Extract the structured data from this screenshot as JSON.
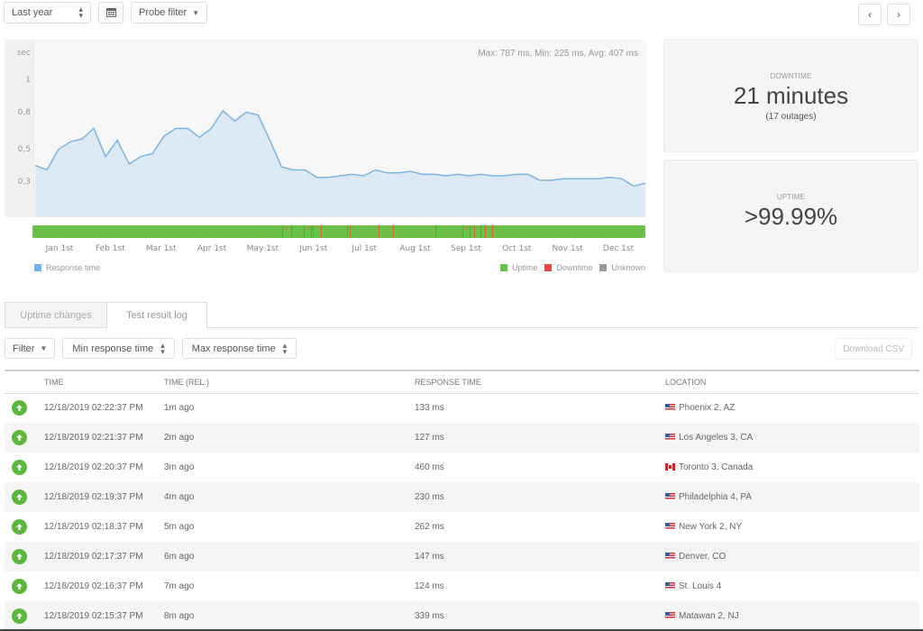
{
  "toolbar": {
    "period_label": "Last year",
    "calendar_icon": "calendar-icon",
    "probe_filter_label": "Probe filter",
    "prev_icon": "chevron-left-icon",
    "next_icon": "chevron-right-icon",
    "prev_glyph": "‹",
    "next_glyph": "›"
  },
  "chart_data": {
    "type": "area",
    "title": "",
    "ylabel": "sec",
    "stats_text": "Max: 787 ms, Min: 225 ms, Avg: 407 ms",
    "ytick_labels": [
      {
        "label": "1",
        "value": 1.0
      },
      {
        "label": "0,8",
        "value": 0.78
      },
      {
        "label": "0,5",
        "value": 0.53
      },
      {
        "label": "0,3",
        "value": 0.31
      }
    ],
    "ylim": [
      0.08,
      1.28
    ],
    "x_labels": [
      "Jan 1st",
      "Feb 1st",
      "Mar 1st",
      "Apr 1st",
      "May 1st",
      "Jun 1st",
      "Jul 1st",
      "Aug 1st",
      "Sep 1st",
      "Oct 1st",
      "Nov 1st",
      "Dec 1st"
    ],
    "series": [
      {
        "name": "Response time",
        "color": "#7cb5e0",
        "fill": "#dde9f5",
        "values": [
          0.43,
          0.4,
          0.54,
          0.59,
          0.61,
          0.68,
          0.49,
          0.6,
          0.44,
          0.49,
          0.51,
          0.63,
          0.68,
          0.68,
          0.62,
          0.68,
          0.8,
          0.73,
          0.79,
          0.77,
          0.6,
          0.42,
          0.4,
          0.4,
          0.35,
          0.35,
          0.36,
          0.37,
          0.36,
          0.4,
          0.38,
          0.38,
          0.39,
          0.37,
          0.37,
          0.36,
          0.37,
          0.36,
          0.37,
          0.36,
          0.36,
          0.37,
          0.37,
          0.33,
          0.33,
          0.34,
          0.34,
          0.34,
          0.34,
          0.35,
          0.34,
          0.29,
          0.31
        ]
      }
    ],
    "status_bar": {
      "uptime_color": "#6cc04a",
      "downtime_color": "#e04040",
      "downtime_positions_fraction": [
        0.407,
        0.422,
        0.442,
        0.455,
        0.458,
        0.471,
        0.513,
        0.517,
        0.564,
        0.588,
        0.658,
        0.701,
        0.713,
        0.72,
        0.731,
        0.738,
        0.75
      ]
    },
    "legend": {
      "left": [
        {
          "label": "Response time",
          "color": "#6cb4ee"
        }
      ],
      "right": [
        {
          "label": "Uptime",
          "color": "#6cc04a"
        },
        {
          "label": "Downtime",
          "color": "#e84a4a"
        },
        {
          "label": "Unknown",
          "color": "#999999"
        }
      ]
    }
  },
  "cards": {
    "downtime": {
      "label": "DOWNTIME",
      "value": "21 minutes",
      "sub": "(17 outages)"
    },
    "uptime": {
      "label": "UPTIME",
      "value": ">99.99%"
    }
  },
  "tabs": [
    {
      "label": "Uptime changes",
      "active": false
    },
    {
      "label": "Test result log",
      "active": true
    }
  ],
  "filters": {
    "filter_label": "Filter",
    "min_label": "Min response time",
    "max_label": "Max response time",
    "download_label": "Download CSV"
  },
  "table": {
    "headers": [
      "",
      "TIME",
      "TIME (REL.)",
      "RESPONSE TIME",
      "LOCATION"
    ],
    "rows": [
      {
        "status": "up",
        "time": "12/18/2019 02:22:37 PM",
        "rel": "1m ago",
        "response": "133 ms",
        "flag": "us",
        "location": "Phoenix 2, AZ"
      },
      {
        "status": "up",
        "time": "12/18/2019 02:21:37 PM",
        "rel": "2m ago",
        "response": "127 ms",
        "flag": "us",
        "location": "Los Angeles 3, CA"
      },
      {
        "status": "up",
        "time": "12/18/2019 02:20:37 PM",
        "rel": "3m ago",
        "response": "460 ms",
        "flag": "ca",
        "location": "Toronto 3, Canada"
      },
      {
        "status": "up",
        "time": "12/18/2019 02:19:37 PM",
        "rel": "4m ago",
        "response": "230 ms",
        "flag": "us",
        "location": "Philadelphia 4, PA"
      },
      {
        "status": "up",
        "time": "12/18/2019 02:18:37 PM",
        "rel": "5m ago",
        "response": "262 ms",
        "flag": "us",
        "location": "New York 2, NY"
      },
      {
        "status": "up",
        "time": "12/18/2019 02:17:37 PM",
        "rel": "6m ago",
        "response": "147 ms",
        "flag": "us",
        "location": "Denver, CO"
      },
      {
        "status": "up",
        "time": "12/18/2019 02:16:37 PM",
        "rel": "7m ago",
        "response": "124 ms",
        "flag": "us",
        "location": "St. Louis 4"
      },
      {
        "status": "up",
        "time": "12/18/2019 02:15:37 PM",
        "rel": "8m ago",
        "response": "339 ms",
        "flag": "us",
        "location": "Matawan 2, NJ"
      }
    ]
  }
}
